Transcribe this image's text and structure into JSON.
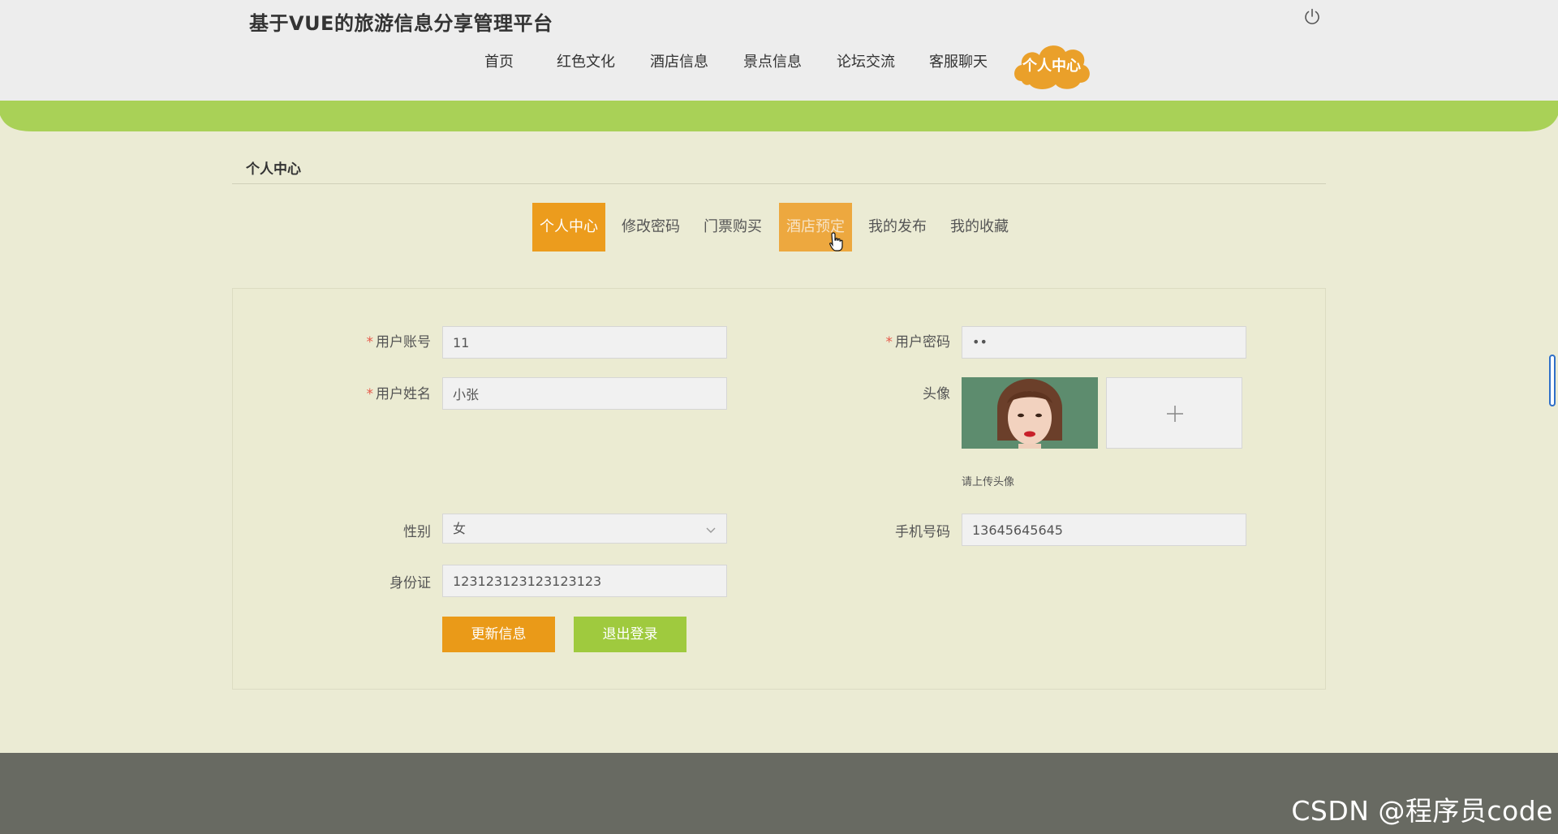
{
  "header": {
    "title": "基于VUE的旅游信息分享管理平台",
    "nav": [
      {
        "label": "首页"
      },
      {
        "label": "红色文化"
      },
      {
        "label": "酒店信息"
      },
      {
        "label": "景点信息"
      },
      {
        "label": "论坛交流"
      },
      {
        "label": "客服聊天"
      }
    ],
    "active_nav": "个人中心",
    "power_icon": "power-icon"
  },
  "section": {
    "title": "个人中心"
  },
  "tabs": [
    {
      "label": "个人中心",
      "state": "active"
    },
    {
      "label": "修改密码",
      "state": "normal"
    },
    {
      "label": "门票购买",
      "state": "normal"
    },
    {
      "label": "酒店预定",
      "state": "hover"
    },
    {
      "label": "我的发布",
      "state": "normal"
    },
    {
      "label": "我的收藏",
      "state": "normal"
    }
  ],
  "form": {
    "account": {
      "label": "用户账号",
      "value": "11",
      "required": true
    },
    "password": {
      "label": "用户密码",
      "value": "••",
      "required": true
    },
    "name": {
      "label": "用户姓名",
      "value": "小张",
      "required": true
    },
    "avatar": {
      "label": "头像",
      "hint": "请上传头像",
      "upload_symbol": "+"
    },
    "gender": {
      "label": "性别",
      "value": "女"
    },
    "phone": {
      "label": "手机号码",
      "value": "13645645645"
    },
    "id_card": {
      "label": "身份证",
      "value": "123123123123123123"
    },
    "required_mark": "*",
    "update_button": "更新信息",
    "logout_button": "退出登录"
  },
  "colors": {
    "accent_orange": "#ec9c1d",
    "accent_green": "#9fca3e",
    "page_bg": "#ebebd4",
    "footer_bg": "#686a62"
  },
  "watermark": "CSDN @程序员code"
}
